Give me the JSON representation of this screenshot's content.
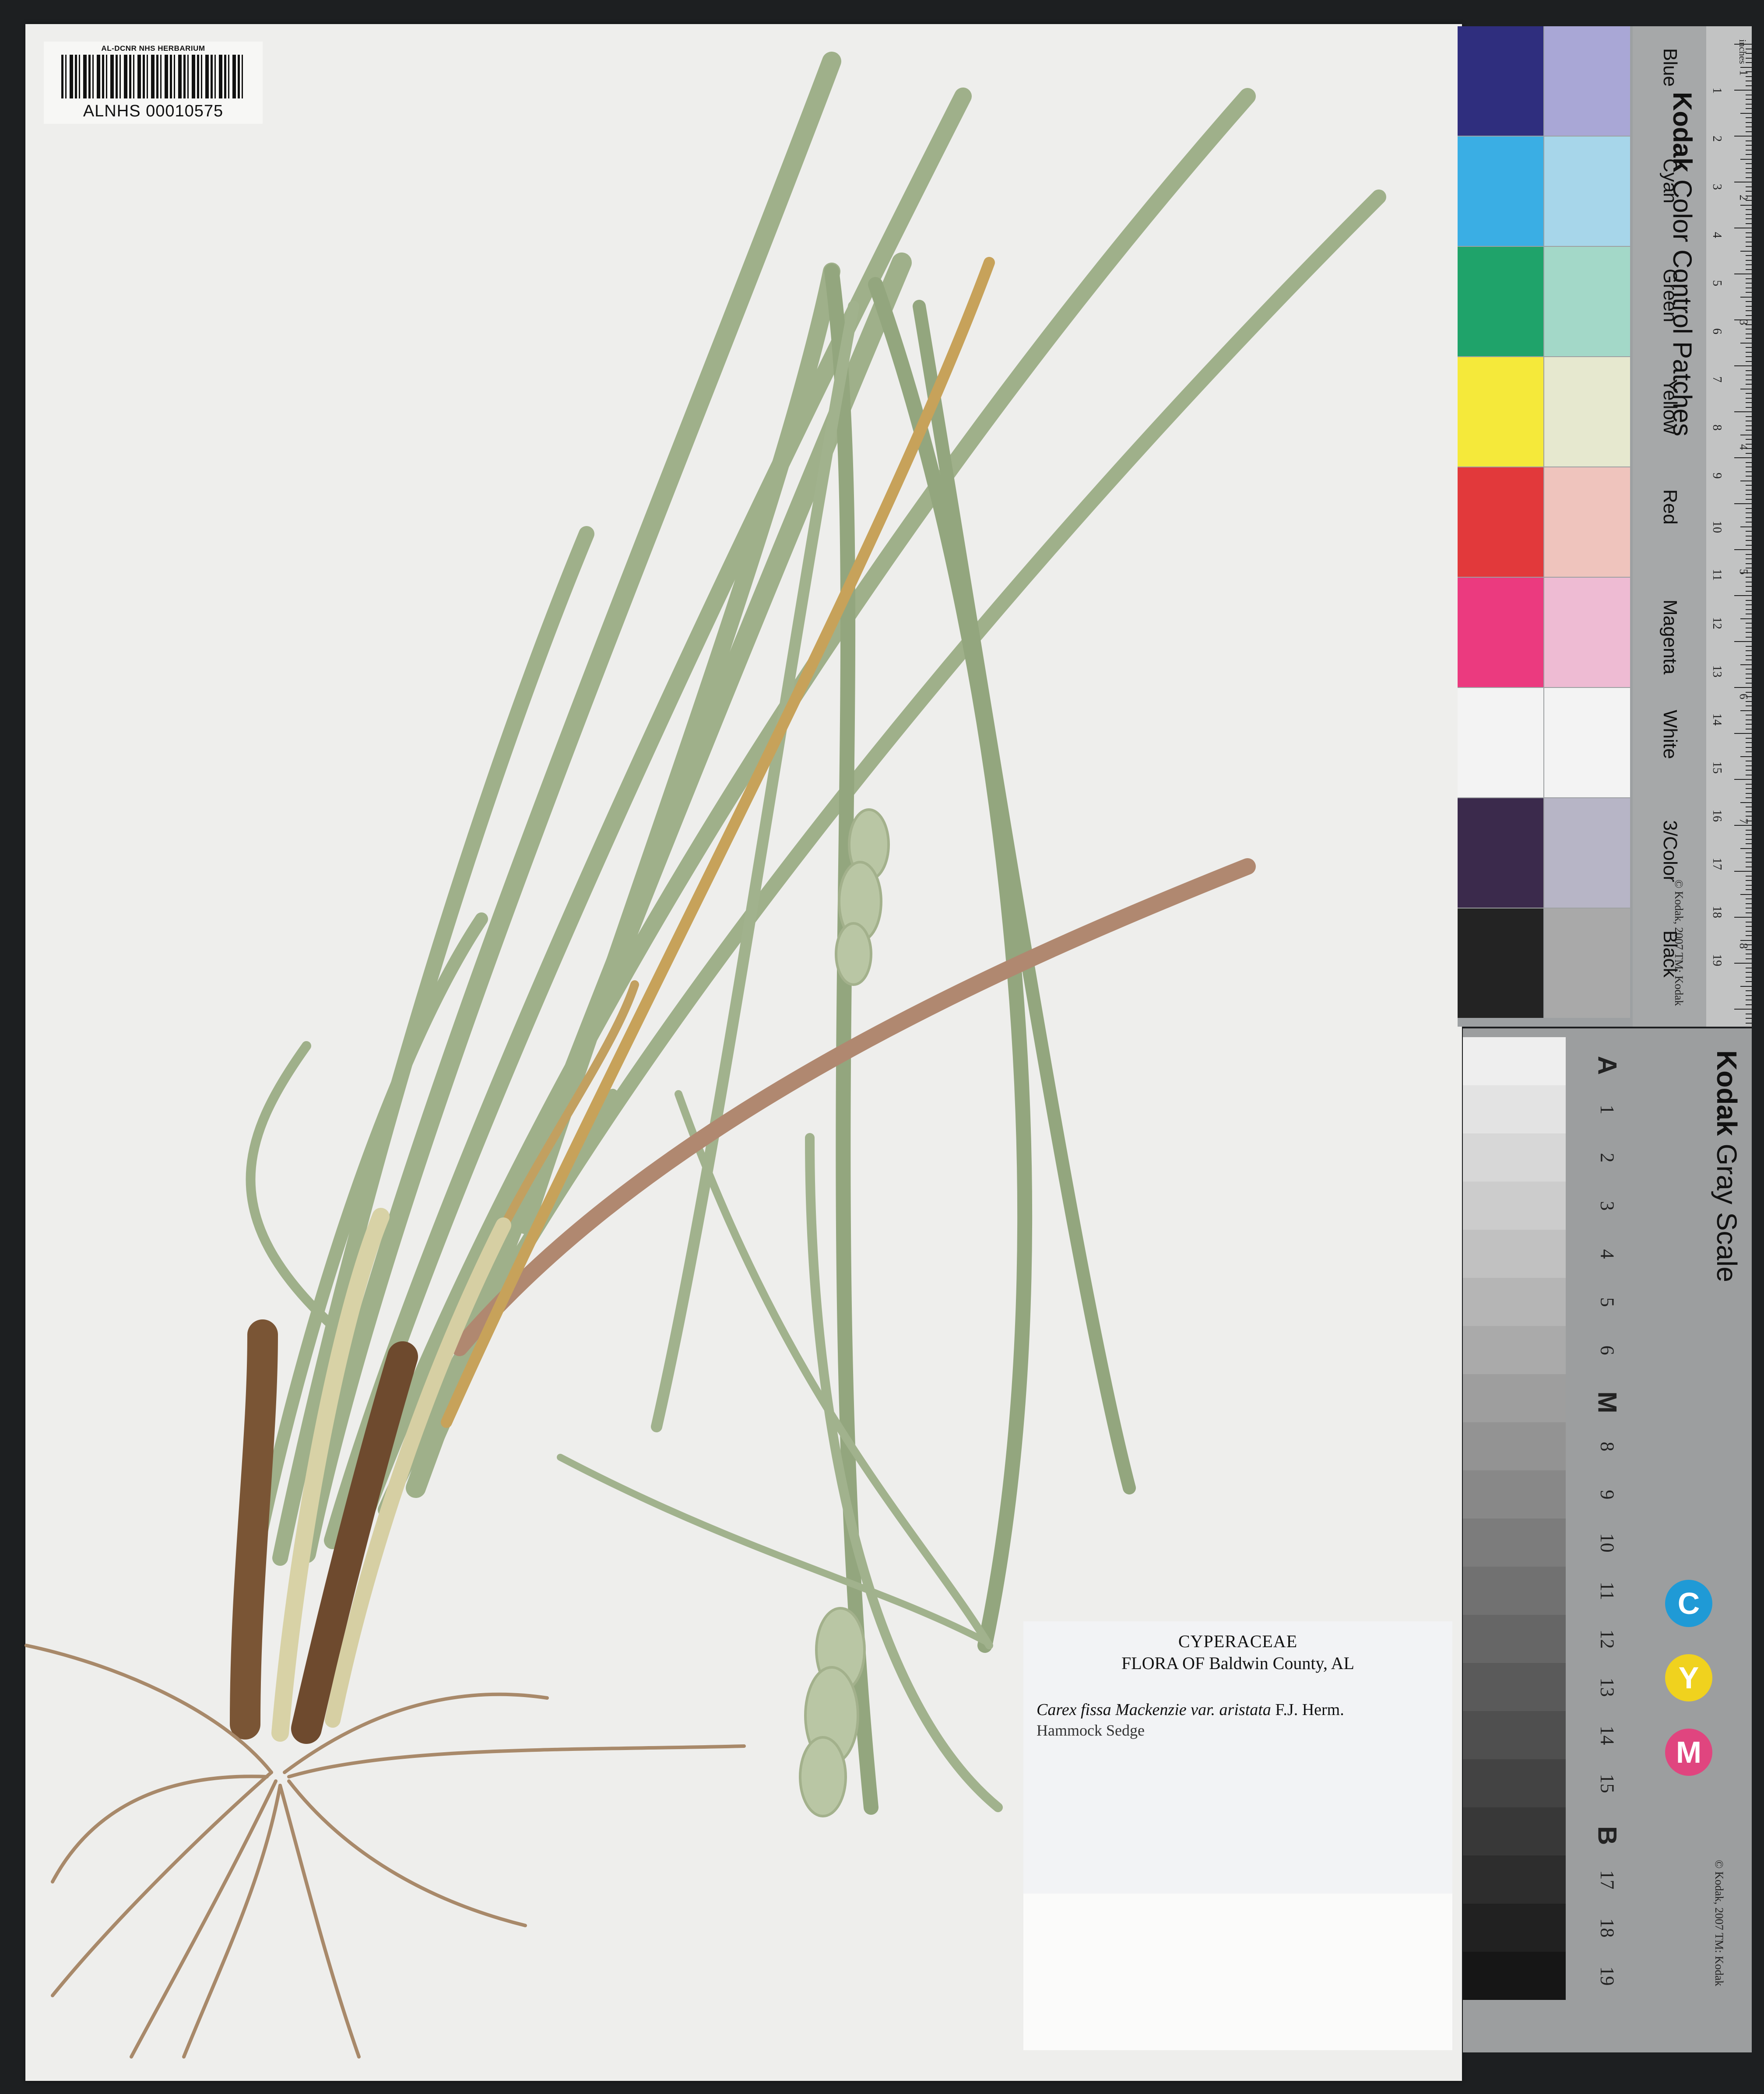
{
  "barcode": {
    "institution": "AL-DCNR NHS HERBARIUM",
    "catalog_number": "ALNHS 00010575"
  },
  "label": {
    "family": "CYPERACEAE",
    "flora": "FLORA OF Baldwin County, AL",
    "scientific_name": "Carex fissa Mackenzie var. aristata",
    "author": "F.J. Herm.",
    "common_name": "Hammock Sedge"
  },
  "color_card": {
    "title_brand": "Kodak",
    "title_rest": "Color Control Patches",
    "copyright": "© Kodak, 2007 TM: Kodak",
    "ruler_unit": "inches",
    "patches": [
      {
        "name": "Blue",
        "dark": "#2f2e7e",
        "light": "#a9a7d6"
      },
      {
        "name": "Cyan",
        "dark": "#3aaee4",
        "light": "#a7d6ea"
      },
      {
        "name": "Green",
        "dark": "#1fa36a",
        "light": "#a3d8c8"
      },
      {
        "name": "Yellow",
        "dark": "#f5e93a",
        "light": "#e6e8cf"
      },
      {
        "name": "Red",
        "dark": "#e2393b",
        "light": "#efc4bd"
      },
      {
        "name": "Magenta",
        "dark": "#eb3a7f",
        "light": "#eebbd3"
      },
      {
        "name": "White",
        "dark": "#f3f3f3",
        "light": "#f3f3f3"
      },
      {
        "name": "3/Color",
        "dark": "#3b2a4c",
        "light": "#b7b5c6"
      },
      {
        "name": "Black",
        "dark": "#232323",
        "light": "#a9a9a9"
      }
    ],
    "cm_numbers": [
      "1",
      "2",
      "3",
      "4",
      "5",
      "6",
      "7",
      "8",
      "9",
      "10",
      "11",
      "12",
      "13",
      "14",
      "15",
      "16",
      "17",
      "18",
      "19"
    ],
    "inch_numbers": [
      "1",
      "2",
      "3",
      "4",
      "5",
      "6",
      "7",
      "8"
    ]
  },
  "gray_scale": {
    "title_brand": "Kodak",
    "title_rest": "Gray Scale",
    "copyright": "© Kodak, 2007 TM: Kodak",
    "steps": [
      "A",
      "1",
      "2",
      "3",
      "4",
      "5",
      "6",
      "M",
      "8",
      "9",
      "10",
      "11",
      "12",
      "13",
      "14",
      "15",
      "B",
      "17",
      "18",
      "19"
    ],
    "cmy": [
      "C",
      "Y",
      "M"
    ],
    "cmy_colors": [
      "#1f9ad6",
      "#f0d21e",
      "#e0457f"
    ]
  },
  "colors": {
    "leaf": "#9fb08a",
    "leaf_dark": "#7e9470",
    "stem_brown": "#7a5535",
    "spike": "#b9c6a4"
  }
}
